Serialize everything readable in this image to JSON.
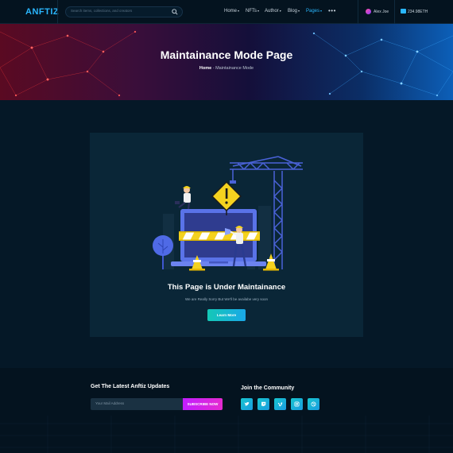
{
  "brand": {
    "logo": "ANFTIZ"
  },
  "search": {
    "placeholder": "Search items, collections, and creators"
  },
  "nav": {
    "items": [
      {
        "label": "Home",
        "caret": "▾"
      },
      {
        "label": "NFTs",
        "caret": "▾"
      },
      {
        "label": "Author",
        "caret": "▾"
      },
      {
        "label": "Blog",
        "caret": "▾"
      },
      {
        "label": "Pages",
        "caret": "▾"
      }
    ],
    "more": "•••",
    "user": "Alex Joe",
    "wallet": "234.98ETH"
  },
  "hero": {
    "title": "Maintainance Mode Page",
    "crumb_home": "Home",
    "crumb_sep": " - ",
    "crumb_current": "Maintainance Mode"
  },
  "maintenance": {
    "title": "This Page is Under Maintainance",
    "subtitle": "We are Really Sorry But We'll be availabe very soon",
    "button": "Learn More"
  },
  "footer": {
    "newsletter_title": "Get The Latest Anftiz Updates",
    "email_placeholder": "Your Mail Address",
    "subscribe": "SUBSCRIBE NOW",
    "community_title": "Join the Community",
    "socials": [
      "twitter-icon",
      "twitch-icon",
      "vimeo-icon",
      "instagram-icon",
      "dribbble-icon"
    ]
  },
  "colors": {
    "accent": "#2ab7ff",
    "background": "#051827",
    "card": "#0a2637",
    "subscribe": "#d02ae8",
    "button": "#17b9cf"
  }
}
